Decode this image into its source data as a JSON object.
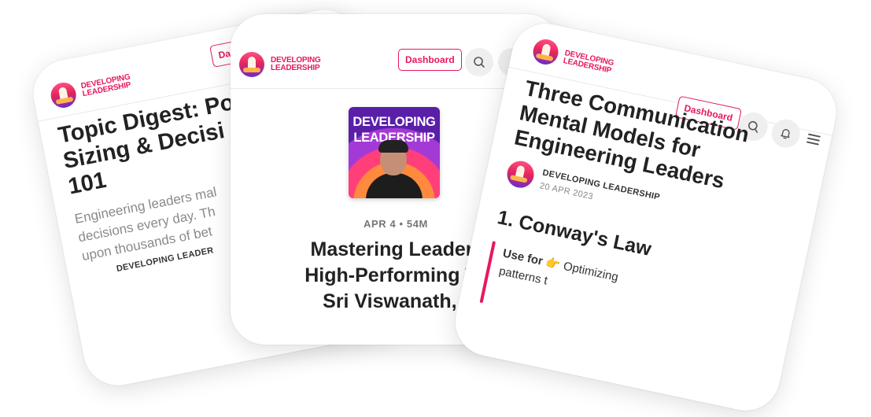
{
  "left_card": {
    "logo": {
      "line1": "DEVELOPING",
      "line2": "LEADERSHIP"
    },
    "dashboard_label": "Dashboard",
    "title_lines": [
      "Topic Digest: Po",
      "Sizing & Decisi",
      "101"
    ],
    "excerpt_lines": [
      "Engineering leaders mal",
      "decisions every day. Th",
      "upon thousands of bet"
    ],
    "byline": "DEVELOPING LEADER"
  },
  "center_card": {
    "logo": {
      "line1": "DEVELOPING",
      "line2": "LEADERSHIP"
    },
    "dashboard_label": "Dashboard",
    "podcast_art": {
      "line1": "DEVELOPING",
      "line2": "LEADERSHIP"
    },
    "meta": "APR 4 • 54M",
    "title_lines": [
      "Mastering Leaders",
      "High-Performing Te",
      "Sri Viswanath, f"
    ]
  },
  "right_card": {
    "logo": {
      "line1": "DEVELOPING",
      "line2": "LEADERSHIP"
    },
    "dashboard_label": "Dashboard",
    "title_lines": [
      "Three Communication",
      "Mental Models for",
      "Engineering Leaders"
    ],
    "author": "DEVELOPING LEADERSHIP",
    "date": "20 APR 2023",
    "section_heading": "1. Conway's Law",
    "use_for_label": "Use for",
    "use_for_emoji": "👉",
    "use_for_text": "Optimizing",
    "use_for_line2": "patterns t"
  }
}
